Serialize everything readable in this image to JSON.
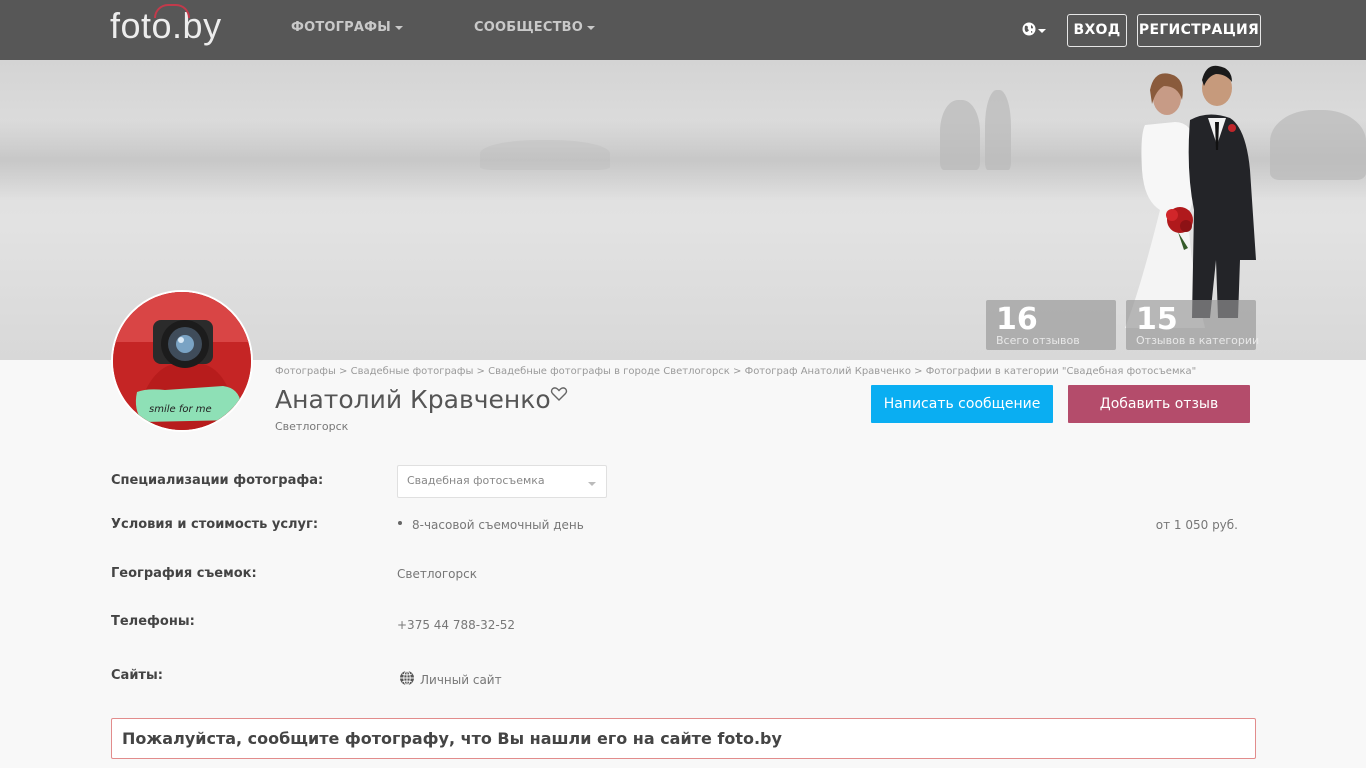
{
  "header": {
    "logo": "foto.by",
    "nav": [
      {
        "label": "ФОТОГРАФЫ"
      },
      {
        "label": "СООБЩЕСТВО"
      }
    ],
    "login": "ВХОД",
    "register": "РЕГИСТРАЦИЯ"
  },
  "banner": {
    "stats": [
      {
        "value": "16",
        "label": "Всего отзывов"
      },
      {
        "value": "15",
        "label": "Отзывов в категории"
      }
    ]
  },
  "avatar": {
    "caption": "smile for me"
  },
  "profile": {
    "breadcrumb": "Фотографы > Свадебные фотографы > Свадебные фотографы в городе Светлогорск > Фотограф Анатолий Кравченко > Фотографии в категории \"Свадебная фотосъемка\"",
    "name": "Анатолий Кравченко",
    "city": "Светлогорск",
    "message_button": "Написать сообщение",
    "review_button": "Добавить отзыв"
  },
  "details": {
    "specializations": {
      "label": "Специализации фотографа:",
      "selected": "Свадебная фотосъемка"
    },
    "services": {
      "label": "Условия и стоимость услуг:",
      "item": "8-часовой съемочный день",
      "price": "от 1 050 руб."
    },
    "geography": {
      "label": "География съемок:",
      "value": "Светлогорск"
    },
    "phones": {
      "label": "Телефоны:",
      "value": "+375 44 788-32-52"
    },
    "sites": {
      "label": "Сайты:",
      "value": "Личный сайт"
    }
  },
  "notice": "Пожалуйста, сообщите фотографу, что Вы нашли его на сайте foto.by",
  "colors": {
    "topbar": "#575757",
    "message_button": "#0aaef2",
    "review_button": "#b44c6b",
    "notice_border": "#e28c8c"
  }
}
